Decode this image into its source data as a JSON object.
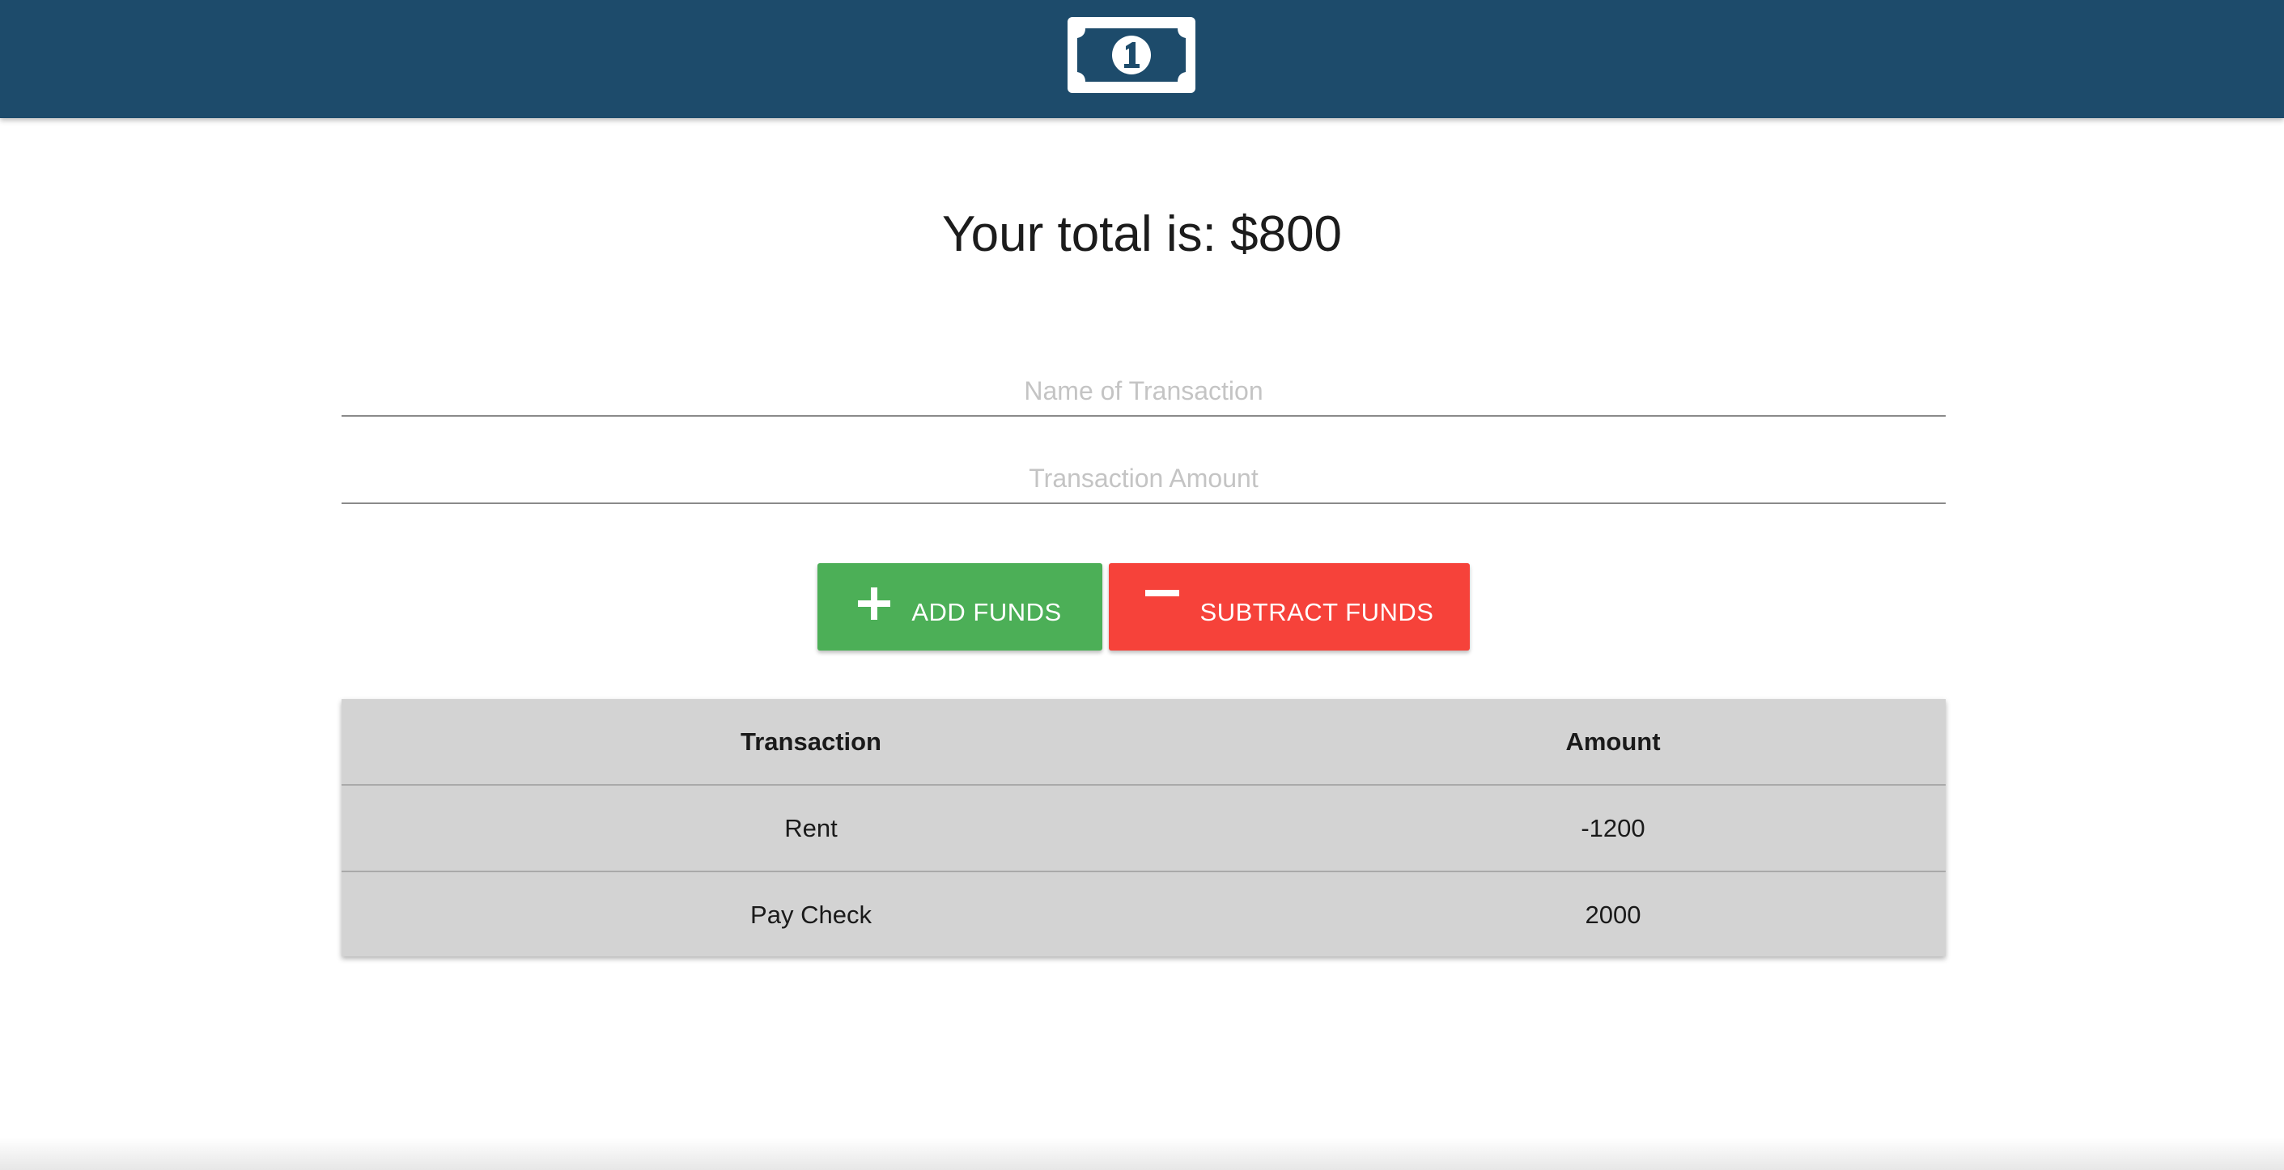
{
  "header": {
    "logo_icon": "dollar-bill-icon",
    "bar_color": "#1d4b6b"
  },
  "summary": {
    "total_text": "Your total is: $800"
  },
  "form": {
    "name_placeholder": "Name of Transaction",
    "name_value": "",
    "amount_placeholder": "Transaction Amount",
    "amount_value": ""
  },
  "buttons": {
    "add_label": "ADD FUNDS",
    "add_icon": "plus-icon",
    "add_color": "#4caf57",
    "subtract_label": "SUBTRACT FUNDS",
    "subtract_icon": "minus-icon",
    "subtract_color": "#f6423a"
  },
  "table": {
    "headers": [
      "Transaction",
      "Amount"
    ],
    "rows": [
      [
        "Rent",
        "-1200"
      ],
      [
        "Pay Check",
        "2000"
      ]
    ]
  }
}
